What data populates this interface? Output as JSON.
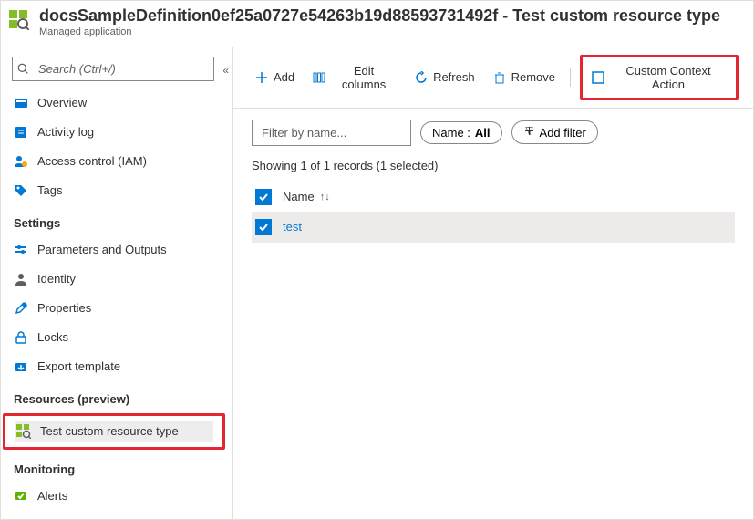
{
  "header": {
    "title": "docsSampleDefinition0ef25a0727e54263b19d88593731492f - Test custom resource type",
    "subtitle": "Managed application"
  },
  "sidebar": {
    "search_placeholder": "Search (Ctrl+/)",
    "items": {
      "overview": "Overview",
      "activity_log": "Activity log",
      "access_control": "Access control (IAM)",
      "tags": "Tags"
    },
    "group_settings": "Settings",
    "settings_items": {
      "parameters": "Parameters and Outputs",
      "identity": "Identity",
      "properties": "Properties",
      "locks": "Locks",
      "export_template": "Export template"
    },
    "group_resources": "Resources (preview)",
    "resources_items": {
      "test_custom": "Test custom resource type"
    },
    "group_monitoring": "Monitoring",
    "monitoring_items": {
      "alerts": "Alerts"
    }
  },
  "toolbar": {
    "add": "Add",
    "edit_columns": "Edit columns",
    "refresh": "Refresh",
    "remove": "Remove",
    "custom_action": "Custom Context Action"
  },
  "filters": {
    "filter_placeholder": "Filter by name...",
    "name_label": "Name :",
    "name_value": "All",
    "add_filter": "Add filter"
  },
  "status": "Showing 1 of 1 records (1 selected)",
  "table": {
    "col_name": "Name",
    "rows": [
      {
        "name": "test"
      }
    ]
  }
}
